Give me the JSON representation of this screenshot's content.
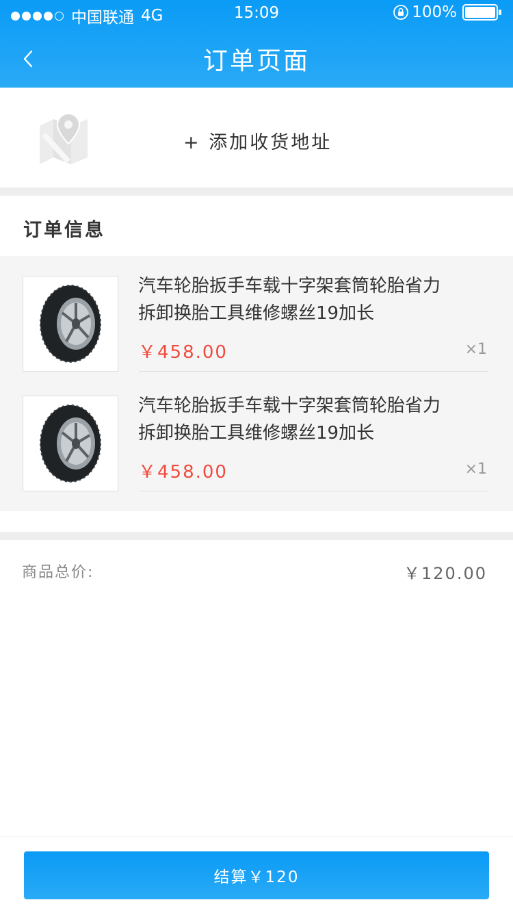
{
  "status_bar": {
    "carrier": "中国联通",
    "network": "4G",
    "time": "15:09",
    "battery": "100%",
    "signal_bars": 4
  },
  "nav": {
    "title": "订单页面",
    "back_icon": "chevron-left-icon"
  },
  "address": {
    "add_label": "+ 添加收货地址",
    "icon": "map-pin-icon"
  },
  "order": {
    "section_title": "订单信息",
    "items": [
      {
        "title_line1": "汽车轮胎扳手车载十字架套筒轮胎省力",
        "title_line2": "拆卸换胎工具维修螺丝19加长",
        "price": "￥458.00",
        "qty": "×1",
        "thumb_icon": "tire-icon"
      },
      {
        "title_line1": "汽车轮胎扳手车载十字架套筒轮胎省力",
        "title_line2": "拆卸换胎工具维修螺丝19加长",
        "price": "￥458.00",
        "qty": "×1",
        "thumb_icon": "tire-icon"
      }
    ]
  },
  "summary": {
    "total_label": "商品总价:",
    "total_value": "￥120.00"
  },
  "checkout": {
    "button_label": "结算￥120"
  },
  "colors": {
    "primary": "#0a9bf6",
    "price": "#f04a3e",
    "band": "#eeeeee",
    "item_bg": "#f5f5f5"
  }
}
